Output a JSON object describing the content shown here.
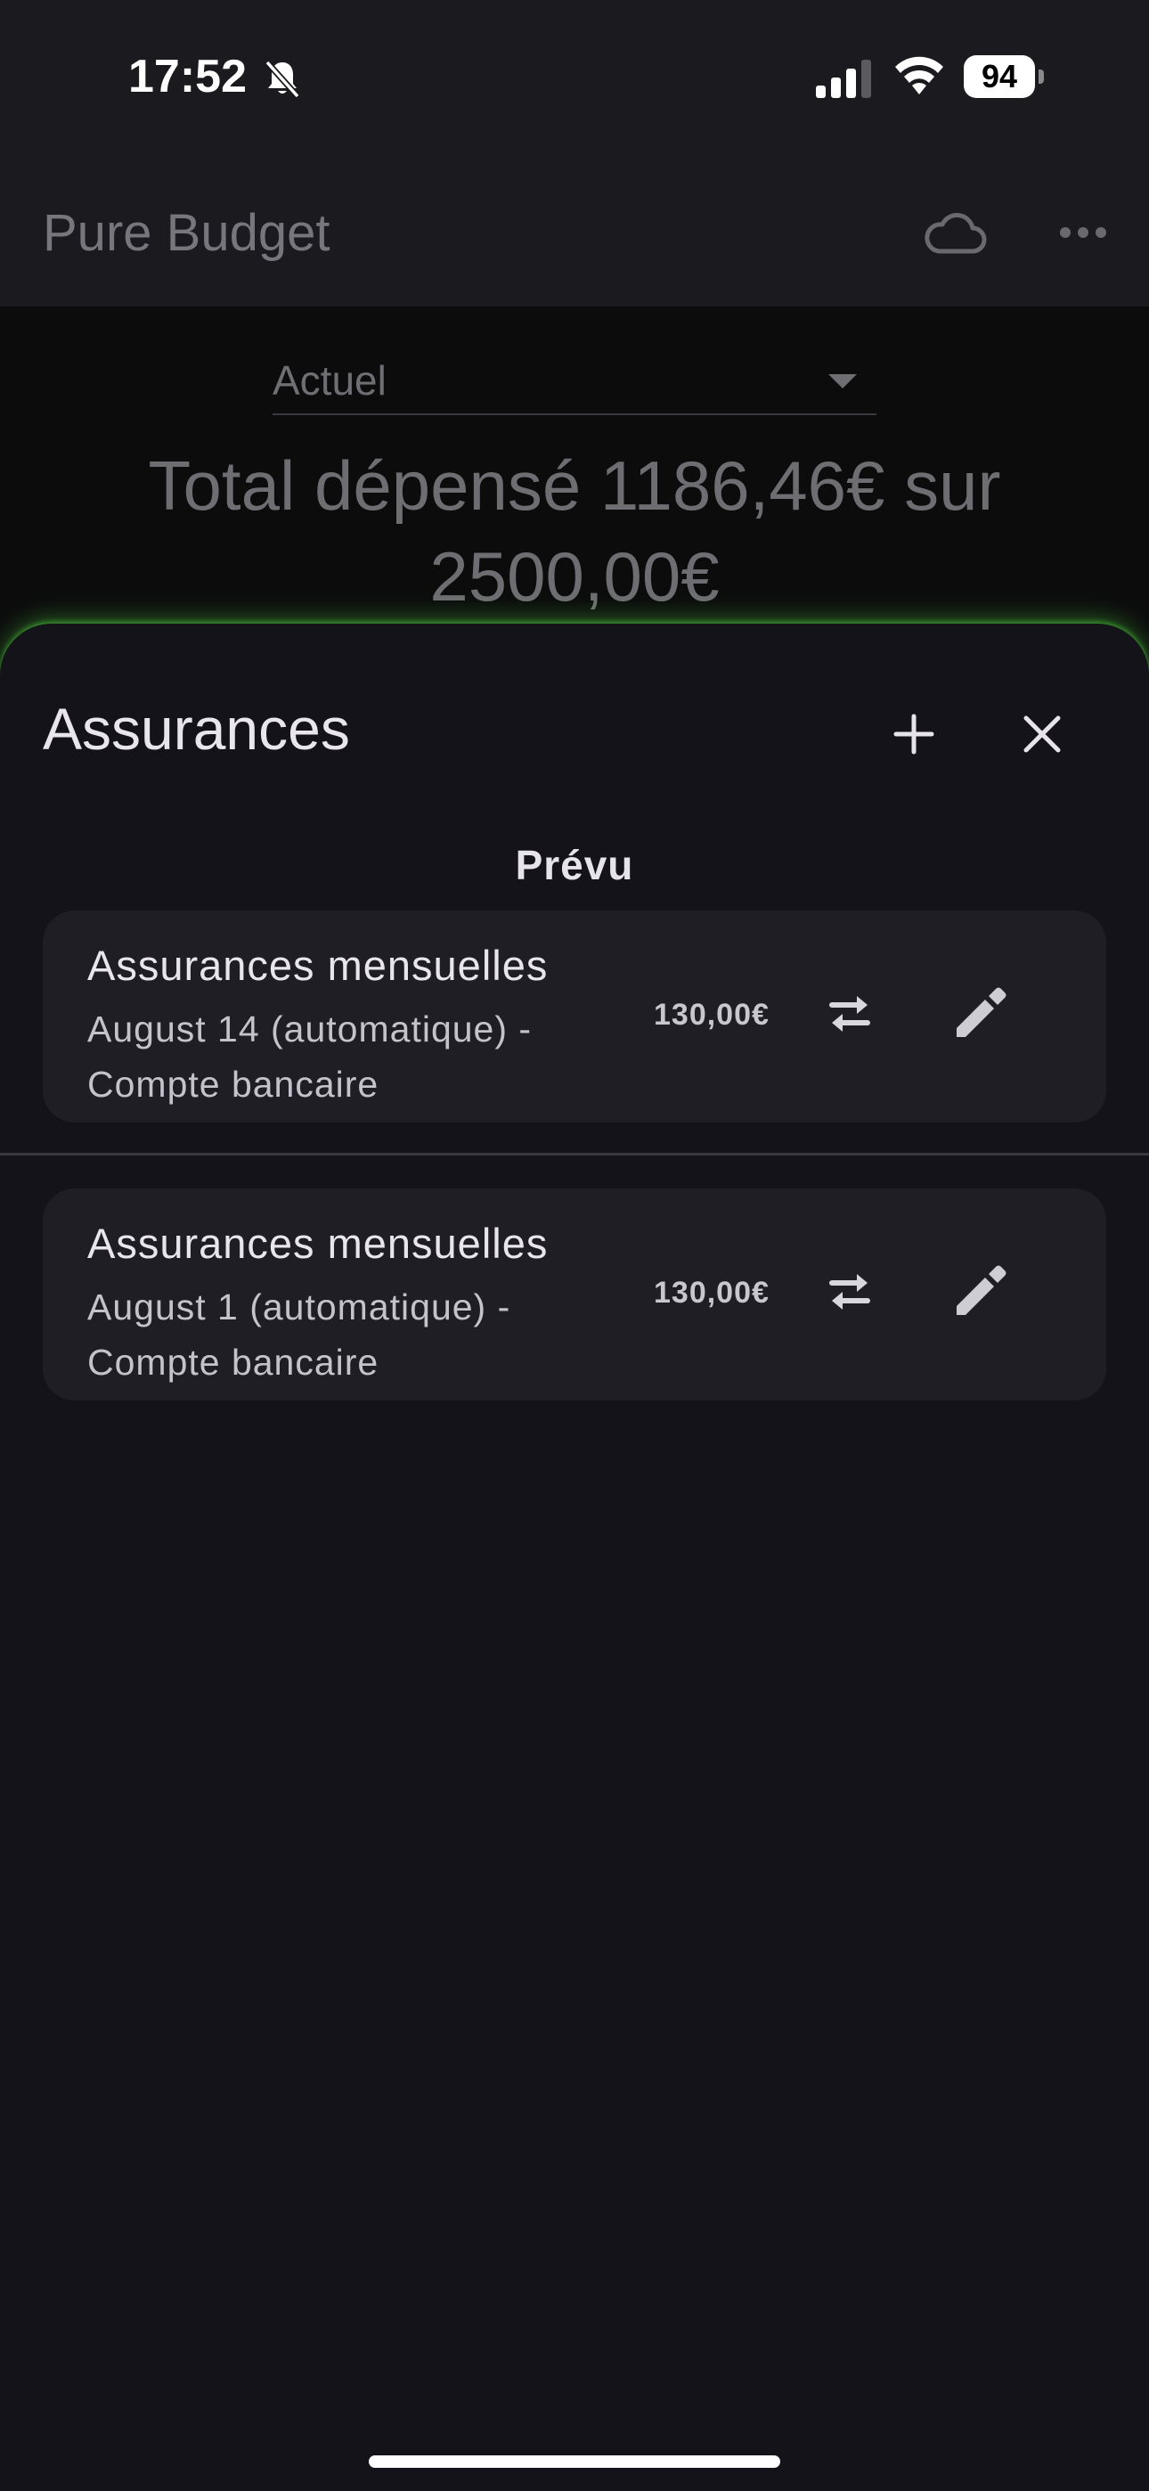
{
  "status_bar": {
    "time": "17:52",
    "battery": "94",
    "icons": [
      "bell-slash-icon",
      "signal-icon",
      "wifi-icon",
      "battery-icon"
    ]
  },
  "app_bar": {
    "title": "Pure Budget",
    "icons": [
      "cloud-icon",
      "more-horizontal-icon"
    ]
  },
  "summary": {
    "period": "Actuel",
    "total_line": "Total dépensé 1186,46€ sur 2500,00€"
  },
  "sheet": {
    "title": "Assurances",
    "section_header": "Prévu",
    "items": [
      {
        "title": "Assurances mensuelles",
        "subtitle": "August 14 (automatique) - Compte bancaire",
        "amount": "130,00€"
      },
      {
        "title": "Assurances mensuelles",
        "subtitle": "August 1 (automatique) - Compte bancaire",
        "amount": "130,00€"
      }
    ]
  },
  "colors": {
    "background": "#131218",
    "card": "#1f1e24",
    "glow": "#4cc83c"
  }
}
